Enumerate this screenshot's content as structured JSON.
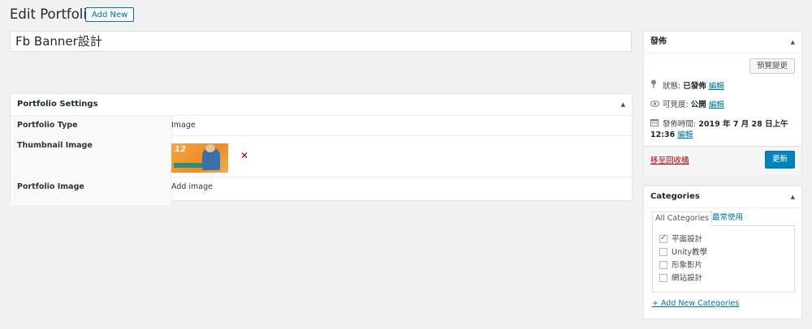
{
  "header": {
    "title": "Edit Portfolio",
    "add_new": "Add New"
  },
  "post": {
    "title": "Fb Banner設計"
  },
  "portfolio_settings": {
    "heading": "Portfolio Settings",
    "rows": [
      {
        "label": "Portfolio Type",
        "value": "Image"
      },
      {
        "label": "Thumbnail Image",
        "thumbnail_text": "12"
      },
      {
        "label": "Portfolio Image",
        "link": "Add image"
      }
    ],
    "remove_icon": "✕"
  },
  "publish": {
    "heading": "發佈",
    "preview": "預覽變更",
    "status_label": "狀態:",
    "status_value": "已發佈",
    "visibility_label": "可見度:",
    "visibility_value": "公開",
    "date_label": "發佈時間:",
    "date_value_line1": "2019 年 7 月 28 日上午",
    "date_value_line2": "12:36",
    "edit": "編輯",
    "trash": "移至回收桶",
    "update": "更新",
    "icons": [
      "pin-icon",
      "eye-icon",
      "calendar-icon"
    ]
  },
  "categories": {
    "heading": "Categories",
    "tab_all": "All Categories",
    "tab_popular": "最常使用",
    "items": [
      {
        "label": "平面設計",
        "checked": true
      },
      {
        "label": "Unity教學",
        "checked": false
      },
      {
        "label": "形象影片",
        "checked": false
      },
      {
        "label": "網站設計",
        "checked": false
      }
    ],
    "add_new": "+ Add New Categories"
  },
  "toggle_icon": "▲",
  "colors": {
    "accent": "#0073aa",
    "primary_button": "#0085ba",
    "danger": "#aa0000",
    "background": "#f1f1f1"
  }
}
